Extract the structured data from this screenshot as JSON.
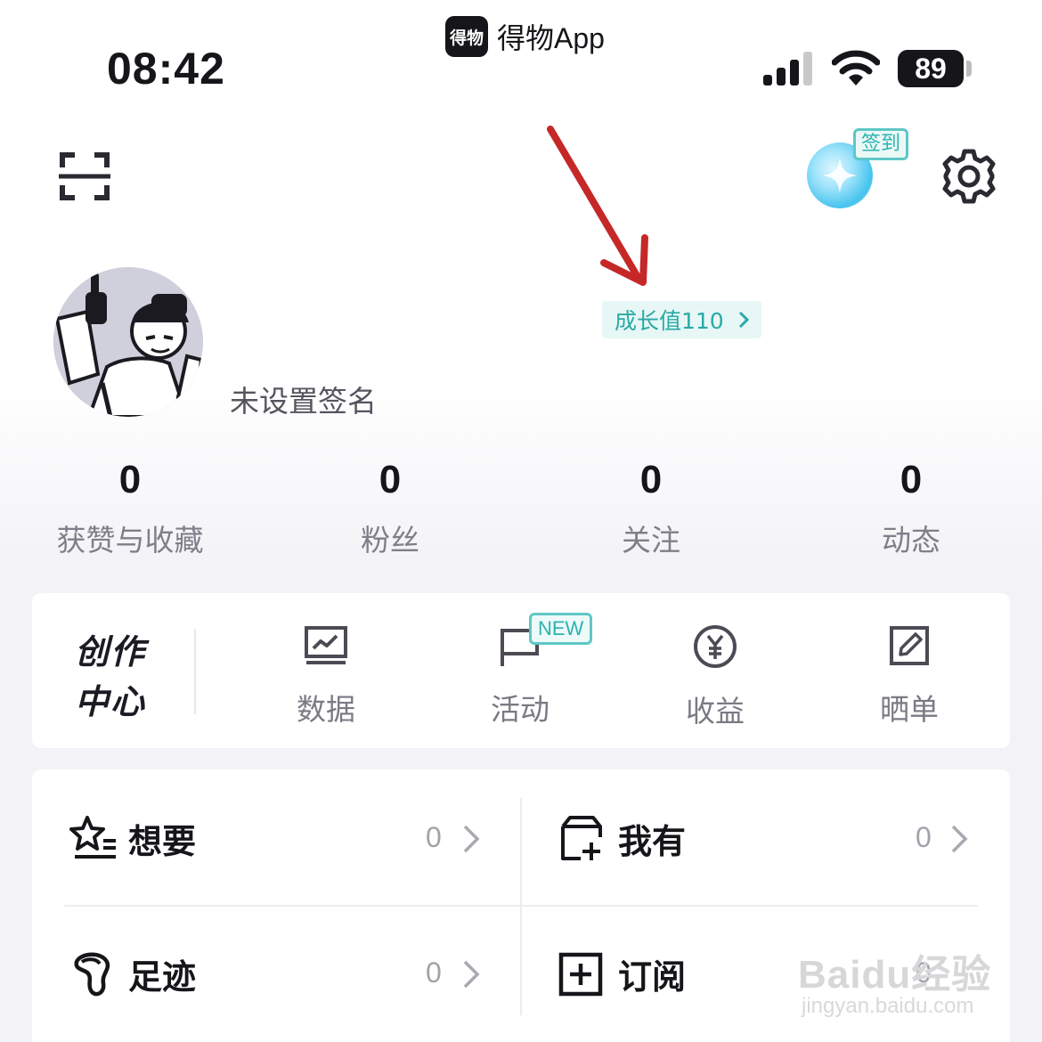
{
  "status_bar": {
    "time": "08:42",
    "app_logo_text": "得物",
    "app_name": "得物App",
    "battery": "89",
    "icons": [
      "signal-icon",
      "wifi-icon",
      "battery-icon"
    ]
  },
  "header": {
    "icons": [
      "scan-icon",
      "gem-icon",
      "gear-icon"
    ],
    "signin_badge": "签到"
  },
  "profile": {
    "growth_label": "成长值110",
    "signature": "未设置签名"
  },
  "stats": [
    {
      "value": "0",
      "label": "获赞与收藏"
    },
    {
      "value": "0",
      "label": "粉丝"
    },
    {
      "value": "0",
      "label": "关注"
    },
    {
      "value": "0",
      "label": "动态"
    }
  ],
  "creator_center": {
    "title_line1": "创作",
    "title_line2": "中心",
    "tools": [
      {
        "label": "数据",
        "icon": "data-chart-icon"
      },
      {
        "label": "活动",
        "icon": "flag-icon"
      },
      {
        "label": "收益",
        "icon": "yuan-icon"
      },
      {
        "label": "晒单",
        "icon": "edit-icon"
      }
    ],
    "new_badge": "NEW"
  },
  "list": [
    {
      "label": "想要",
      "count": "0",
      "icon": "star-list-icon"
    },
    {
      "label": "我有",
      "count": "0",
      "icon": "box-add-icon"
    },
    {
      "label": "足迹",
      "count": "0",
      "icon": "footprint-icon"
    },
    {
      "label": "订阅",
      "count": "0",
      "icon": "subscribe-plus-icon"
    }
  ],
  "colors": {
    "accent_teal": "#2aa9a6",
    "annotation_red": "#c62828"
  },
  "watermark": {
    "main": "Baidu经验",
    "sub": "jingyan.baidu.com"
  }
}
